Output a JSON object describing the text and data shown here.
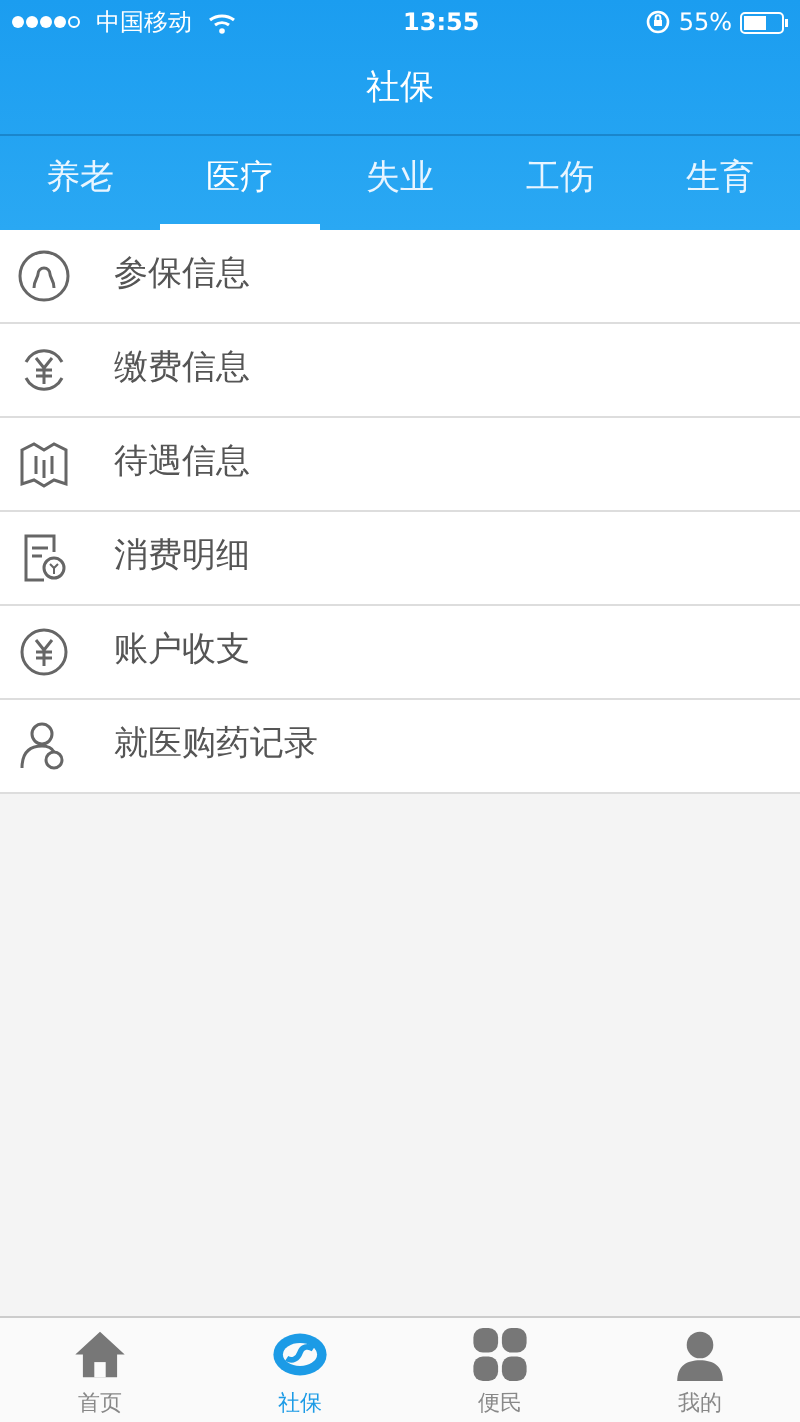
{
  "status_bar": {
    "carrier": "中国移动",
    "time": "13:55",
    "battery": "55%"
  },
  "title": "社保",
  "tabs": [
    {
      "label": "养老",
      "selected": false
    },
    {
      "label": "医疗",
      "selected": true
    },
    {
      "label": "失业",
      "selected": false
    },
    {
      "label": "工伤",
      "selected": false
    },
    {
      "label": "生育",
      "selected": false
    }
  ],
  "menu": [
    {
      "label": "参保信息"
    },
    {
      "label": "缴费信息"
    },
    {
      "label": "待遇信息"
    },
    {
      "label": "消费明细"
    },
    {
      "label": "账户收支"
    },
    {
      "label": "就医购药记录"
    }
  ],
  "bottom_nav": [
    {
      "label": "首页",
      "selected": false
    },
    {
      "label": "社保",
      "selected": true
    },
    {
      "label": "便民",
      "selected": false
    },
    {
      "label": "我的",
      "selected": false
    }
  ]
}
